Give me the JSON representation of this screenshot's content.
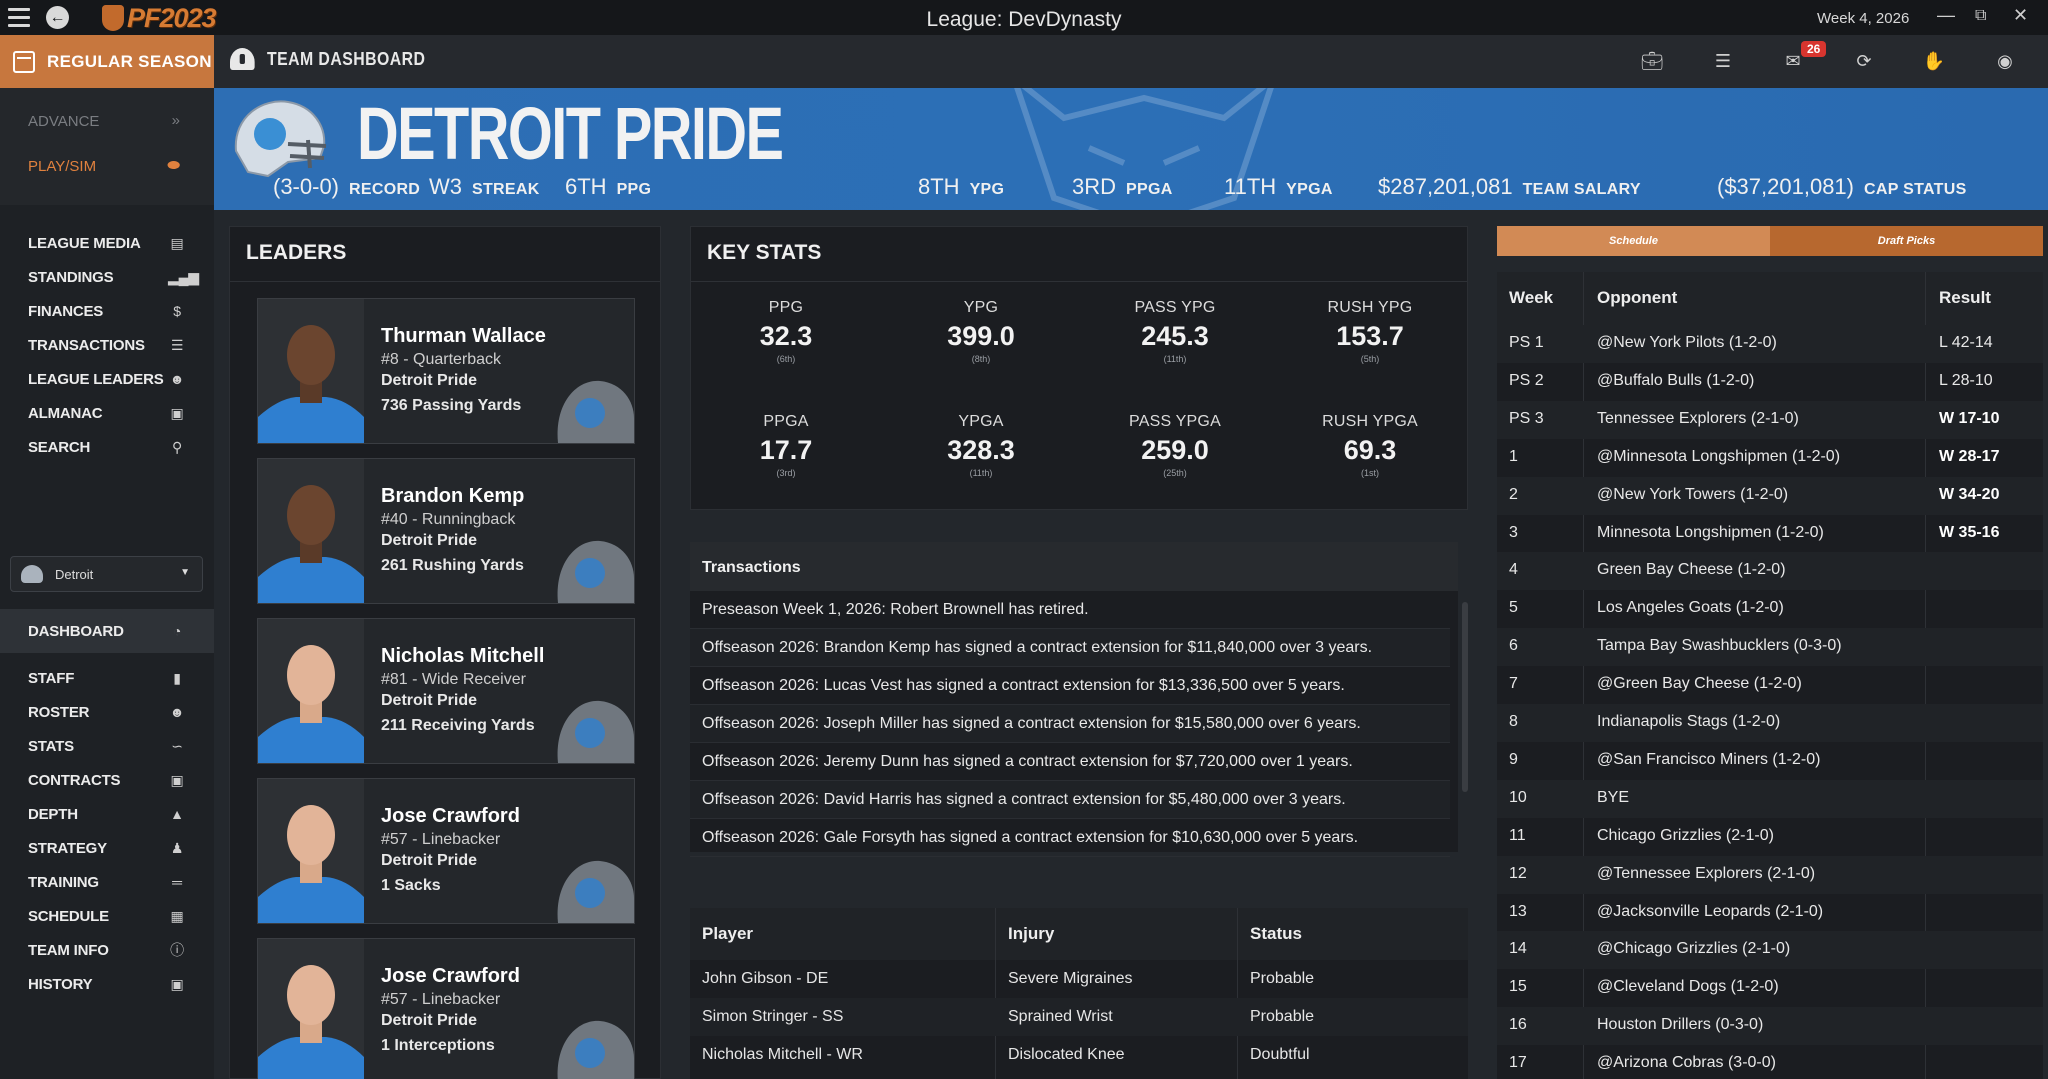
{
  "titlebar": {
    "logo": "PF2023",
    "league": "League: DevDynasty",
    "week": "Week 4, 2026"
  },
  "toolbar": {
    "season_label": "REGULAR SEASON",
    "page_title": "TEAM DASHBOARD",
    "mail_count": "26"
  },
  "sidebar": {
    "advance": "ADVANCE",
    "playsim": "PLAY/SIM",
    "items_top": [
      "LEAGUE MEDIA",
      "STANDINGS",
      "FINANCES",
      "TRANSACTIONS",
      "LEAGUE LEADERS",
      "ALMANAC",
      "SEARCH"
    ],
    "team_select": "Detroit",
    "items_team": [
      "DASHBOARD",
      "STAFF",
      "ROSTER",
      "STATS",
      "CONTRACTS",
      "DEPTH",
      "STRATEGY",
      "TRAINING",
      "SCHEDULE",
      "TEAM INFO",
      "HISTORY"
    ]
  },
  "team": {
    "name": "DETROIT PRIDE",
    "record": "(3-0-0)",
    "record_label": "RECORD",
    "streak": "W3",
    "streak_label": "STREAK",
    "ppg": "6TH",
    "ppg_label": "PPG",
    "ypg": "8TH",
    "ypg_label": "YPG",
    "ppga": "3RD",
    "ppga_label": "PPGA",
    "ypga": "11TH",
    "ypga_label": "YPGA",
    "salary": "$287,201,081",
    "salary_label": "TEAM SALARY",
    "cap": "($37,201,081)",
    "cap_label": "CAP STATUS"
  },
  "leaders": {
    "title": "LEADERS",
    "items": [
      {
        "name": "Thurman Wallace",
        "pos": "#8 - Quarterback",
        "team": "Detroit Pride",
        "stat": "736 Passing Yards"
      },
      {
        "name": "Brandon Kemp",
        "pos": "#40 - Runningback",
        "team": "Detroit Pride",
        "stat": "261 Rushing Yards"
      },
      {
        "name": "Nicholas Mitchell",
        "pos": "#81 - Wide Receiver",
        "team": "Detroit Pride",
        "stat": "211 Receiving Yards"
      },
      {
        "name": "Jose Crawford",
        "pos": "#57 - Linebacker",
        "team": "Detroit Pride",
        "stat": "1 Sacks"
      },
      {
        "name": "Jose Crawford",
        "pos": "#57 - Linebacker",
        "team": "Detroit Pride",
        "stat": "1 Interceptions"
      }
    ]
  },
  "keystats": {
    "title": "KEY STATS",
    "items": [
      {
        "label": "PPG",
        "value": "32.3",
        "rank": "(6th)"
      },
      {
        "label": "YPG",
        "value": "399.0",
        "rank": "(8th)"
      },
      {
        "label": "PASS YPG",
        "value": "245.3",
        "rank": "(11th)"
      },
      {
        "label": "RUSH YPG",
        "value": "153.7",
        "rank": "(5th)"
      },
      {
        "label": "PPGA",
        "value": "17.7",
        "rank": "(3rd)"
      },
      {
        "label": "YPGA",
        "value": "328.3",
        "rank": "(11th)"
      },
      {
        "label": "PASS YPGA",
        "value": "259.0",
        "rank": "(25th)"
      },
      {
        "label": "RUSH YPGA",
        "value": "69.3",
        "rank": "(1st)"
      }
    ]
  },
  "transactions": {
    "title": "Transactions",
    "rows": [
      "Preseason Week 1, 2026: Robert Brownell has retired.",
      "Offseason 2026: Brandon Kemp has signed a contract extension for $11,840,000 over 3 years.",
      "Offseason 2026: Lucas Vest has signed a contract extension for $13,336,500 over 5 years.",
      "Offseason 2026: Joseph Miller has signed a contract extension for $15,580,000 over 6 years.",
      "Offseason 2026: Jeremy Dunn has signed a contract extension for $7,720,000 over 1 years.",
      "Offseason 2026: David Harris has signed a contract extension for $5,480,000 over 3 years.",
      "Offseason 2026: Gale Forsyth has signed a contract extension for $10,630,000 over 5 years."
    ]
  },
  "injuries": {
    "headers": [
      "Player",
      "Injury",
      "Status"
    ],
    "rows": [
      {
        "player": "John Gibson - DE",
        "injury": "Severe Migraines",
        "status": "Probable"
      },
      {
        "player": "Simon Stringer - SS",
        "injury": "Sprained Wrist",
        "status": "Probable"
      },
      {
        "player": "Nicholas Mitchell - WR",
        "injury": "Dislocated Knee",
        "status": "Doubtful"
      }
    ]
  },
  "schedule": {
    "tabs": [
      "Schedule",
      "Draft Picks"
    ],
    "headers": [
      "Week",
      "Opponent",
      "Result"
    ],
    "rows": [
      {
        "week": "PS 1",
        "opp": "@New York Pilots (1-2-0)",
        "res": "L 42-14"
      },
      {
        "week": "PS 2",
        "opp": "@Buffalo Bulls (1-2-0)",
        "res": "L 28-10"
      },
      {
        "week": "PS 3",
        "opp": "Tennessee Explorers (2-1-0)",
        "res": "W 17-10"
      },
      {
        "week": "1",
        "opp": "@Minnesota Longshipmen (1-2-0)",
        "res": "W 28-17"
      },
      {
        "week": "2",
        "opp": "@New York Towers (1-2-0)",
        "res": "W 34-20"
      },
      {
        "week": "3",
        "opp": "Minnesota Longshipmen (1-2-0)",
        "res": "W 35-16"
      },
      {
        "week": "4",
        "opp": "Green Bay Cheese (1-2-0)",
        "res": ""
      },
      {
        "week": "5",
        "opp": "Los Angeles Goats (1-2-0)",
        "res": ""
      },
      {
        "week": "6",
        "opp": "Tampa Bay Swashbucklers (0-3-0)",
        "res": ""
      },
      {
        "week": "7",
        "opp": "@Green Bay Cheese (1-2-0)",
        "res": ""
      },
      {
        "week": "8",
        "opp": "Indianapolis Stags (1-2-0)",
        "res": ""
      },
      {
        "week": "9",
        "opp": "@San Francisco Miners (1-2-0)",
        "res": ""
      },
      {
        "week": "10",
        "opp": "BYE",
        "res": ""
      },
      {
        "week": "11",
        "opp": "Chicago Grizzlies (2-1-0)",
        "res": ""
      },
      {
        "week": "12",
        "opp": "@Tennessee Explorers (2-1-0)",
        "res": ""
      },
      {
        "week": "13",
        "opp": "@Jacksonville Leopards (2-1-0)",
        "res": ""
      },
      {
        "week": "14",
        "opp": "@Chicago Grizzlies (2-1-0)",
        "res": ""
      },
      {
        "week": "15",
        "opp": "@Cleveland Dogs (1-2-0)",
        "res": ""
      },
      {
        "week": "16",
        "opp": "Houston Drillers (0-3-0)",
        "res": ""
      },
      {
        "week": "17",
        "opp": "@Arizona Cobras (3-0-0)",
        "res": ""
      }
    ]
  },
  "colors": {
    "accent": "#c7773e",
    "banner": "#2d6eb4",
    "alert": "#d8352f"
  }
}
